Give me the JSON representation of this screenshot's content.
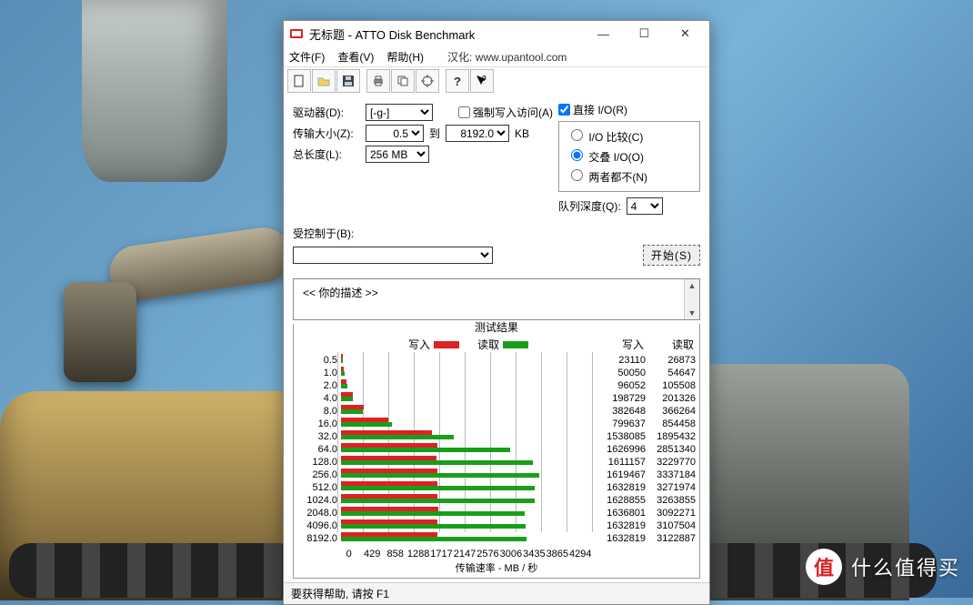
{
  "window": {
    "title": "无标题 - ATTO Disk Benchmark",
    "min": "—",
    "max": "☐",
    "close": "✕"
  },
  "menu": {
    "file": "文件(F)",
    "view": "查看(V)",
    "help": "帮助(H)",
    "note_label": "汉化:",
    "note_url": "www.upantool.com"
  },
  "toolbar": {
    "new": "new",
    "open": "open",
    "save": "save",
    "print": "print",
    "copy": "copy",
    "grid": "grid",
    "help": "help",
    "ctxhelp": "ctxhelp"
  },
  "opts": {
    "drive_label": "驱动器(D):",
    "drive_value": "[-g-]",
    "xfer_label": "传输大小(Z):",
    "xfer_from": "0.5",
    "xfer_to_label": "到",
    "xfer_to": "8192.0",
    "xfer_unit": "KB",
    "len_label": "总长度(L):",
    "len_value": "256 MB",
    "force_label": "强制写入访问(A)",
    "direct_label": "直接 I/O(R)",
    "radio_compare": "I/O 比较(C)",
    "radio_overlap": "交叠 I/O(O)",
    "radio_neither": "两者都不(N)",
    "queue_label": "队列深度(Q):",
    "queue_value": "4",
    "controlled_label": "受控制于(B):",
    "controlled_value": "",
    "start_btn": "开始(S)",
    "desc": "<<  你的描述   >>"
  },
  "results": {
    "title": "测试结果",
    "hdr_write": "写入",
    "hdr_read": "读取",
    "xlabel": "传输速率 - MB / 秒"
  },
  "status": "要获得帮助, 请按 F1",
  "watermark": {
    "badge": "值",
    "text": "什么值得买"
  },
  "chart_data": {
    "type": "bar",
    "orientation": "horizontal",
    "series_names": [
      "写入",
      "读取"
    ],
    "colors": {
      "写入": "#d22",
      "读取": "#1a9e1a"
    },
    "y_categories_kb": [
      "0.5",
      "1.0",
      "2.0",
      "4.0",
      "8.0",
      "16.0",
      "32.0",
      "64.0",
      "128.0",
      "256.0",
      "512.0",
      "1024.0",
      "2048.0",
      "4096.0",
      "8192.0"
    ],
    "x_ticks": [
      0,
      429,
      858,
      1288,
      1717,
      2147,
      2576,
      3006,
      3435,
      3865,
      4294
    ],
    "x_range": [
      0,
      4294
    ],
    "xlabel": "传输速率 - MB / 秒",
    "unit_values": "KB/s",
    "rows": [
      {
        "size_kb": "0.5",
        "write": 23110,
        "read": 26873
      },
      {
        "size_kb": "1.0",
        "write": 50050,
        "read": 54647
      },
      {
        "size_kb": "2.0",
        "write": 96052,
        "read": 105508
      },
      {
        "size_kb": "4.0",
        "write": 198729,
        "read": 201326
      },
      {
        "size_kb": "8.0",
        "write": 382648,
        "read": 366264
      },
      {
        "size_kb": "16.0",
        "write": 799637,
        "read": 854458
      },
      {
        "size_kb": "32.0",
        "write": 1538085,
        "read": 1895432
      },
      {
        "size_kb": "64.0",
        "write": 1626996,
        "read": 2851340
      },
      {
        "size_kb": "128.0",
        "write": 1611157,
        "read": 3229770
      },
      {
        "size_kb": "256.0",
        "write": 1619467,
        "read": 3337184
      },
      {
        "size_kb": "512.0",
        "write": 1632819,
        "read": 3271974
      },
      {
        "size_kb": "1024.0",
        "write": 1628855,
        "read": 3263855
      },
      {
        "size_kb": "2048.0",
        "write": 1636801,
        "read": 3092271
      },
      {
        "size_kb": "4096.0",
        "write": 1632819,
        "read": 3107504
      },
      {
        "size_kb": "8192.0",
        "write": 1632819,
        "read": 3122887
      }
    ]
  }
}
